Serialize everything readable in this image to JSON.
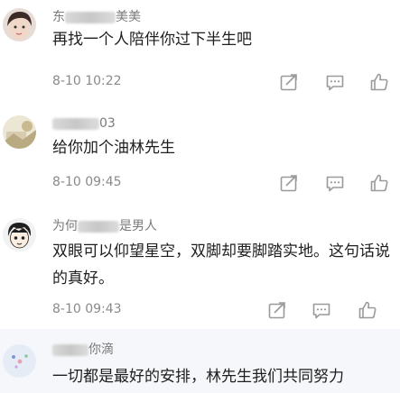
{
  "comments": [
    {
      "username_visible": "美美",
      "username_prefix": "东",
      "text": "再找一个人陪伴你过下半生吧",
      "time": "8-10 10:22"
    },
    {
      "username_visible": "03",
      "text": "给你加个油林先生",
      "time": "8-10 09:45"
    },
    {
      "username_prefix": "为何",
      "username_visible": "是男人",
      "text": "双眼可以仰望星空，双脚却要脚踏实地。这句话说的真好。",
      "time": "8-10 09:43"
    },
    {
      "username_visible": "你滴",
      "text": "一切都是最好的安排，林先生我们共同努力"
    }
  ],
  "icons": {
    "share": "share-icon",
    "reply": "comment-icon",
    "like": "thumbs-up-icon"
  },
  "colors": {
    "text": "#1e1e1e",
    "meta": "#8a8a8a",
    "icon": "#9a9a9a"
  }
}
